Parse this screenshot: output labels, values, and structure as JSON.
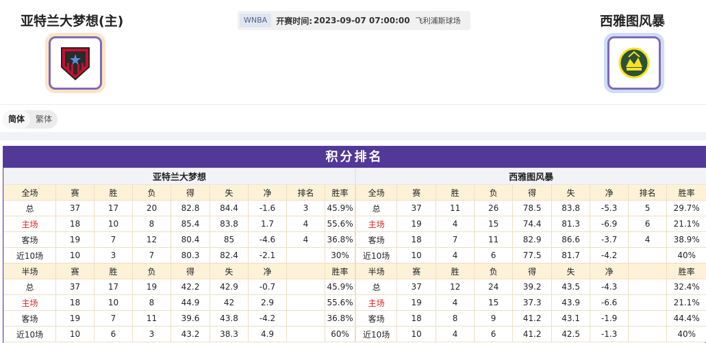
{
  "header": {
    "home_team": "亚特兰大梦想(主)",
    "away_team": "西雅图风暴",
    "league": "WNBA",
    "start_label": "开赛时间:",
    "start_time": "2023-09-07 07:00:00",
    "venue": "飞利浦斯球场",
    "home_ring_color": "#fbe4c7",
    "away_ring_color": "#cfdcfb"
  },
  "lang": {
    "simplified": "简体",
    "traditional": "繁体"
  },
  "panel": {
    "title": "积分排名",
    "accent": "#523897",
    "home_caption": "亚特兰大梦想",
    "away_caption": "西雅图风暴",
    "home": [
      [
        "全场",
        "赛",
        "胜",
        "负",
        "得",
        "失",
        "净",
        "排名",
        "胜率"
      ],
      [
        "总",
        "37",
        "17",
        "20",
        "82.8",
        "84.4",
        "-1.6",
        "3",
        "45.9%"
      ],
      [
        "主场",
        "18",
        "10",
        "8",
        "85.4",
        "83.8",
        "1.7",
        "4",
        "55.6%"
      ],
      [
        "客场",
        "19",
        "7",
        "12",
        "80.4",
        "85",
        "-4.6",
        "4",
        "36.8%"
      ],
      [
        "近10场",
        "10",
        "3",
        "7",
        "80.3",
        "82.4",
        "-2.1",
        "",
        "30%"
      ],
      [
        "半场",
        "赛",
        "胜",
        "负",
        "得",
        "失",
        "净",
        "",
        "胜率"
      ],
      [
        "总",
        "37",
        "17",
        "19",
        "42.2",
        "42.9",
        "-0.7",
        "",
        "45.9%"
      ],
      [
        "主场",
        "18",
        "10",
        "8",
        "44.9",
        "42",
        "2.9",
        "",
        "55.6%"
      ],
      [
        "客场",
        "19",
        "7",
        "11",
        "39.6",
        "43.8",
        "-4.2",
        "",
        "36.8%"
      ],
      [
        "近10场",
        "10",
        "6",
        "3",
        "43.2",
        "38.3",
        "4.9",
        "",
        "60%"
      ]
    ],
    "away": [
      [
        "全场",
        "赛",
        "胜",
        "负",
        "得",
        "失",
        "净",
        "排名",
        "胜率"
      ],
      [
        "总",
        "37",
        "11",
        "26",
        "78.5",
        "83.8",
        "-5.3",
        "5",
        "29.7%"
      ],
      [
        "主场",
        "19",
        "4",
        "15",
        "74.4",
        "81.3",
        "-6.9",
        "6",
        "21.1%"
      ],
      [
        "客场",
        "18",
        "7",
        "11",
        "82.9",
        "86.6",
        "-3.7",
        "4",
        "38.9%"
      ],
      [
        "近10场",
        "10",
        "4",
        "6",
        "77.5",
        "81.7",
        "-4.2",
        "",
        "40%"
      ],
      [
        "半场",
        "赛",
        "胜",
        "负",
        "得",
        "失",
        "净",
        "",
        "胜率"
      ],
      [
        "总",
        "37",
        "12",
        "24",
        "39.2",
        "43.5",
        "-4.3",
        "",
        "32.4%"
      ],
      [
        "主场",
        "19",
        "4",
        "15",
        "37.3",
        "43.9",
        "-6.6",
        "",
        "21.1%"
      ],
      [
        "客场",
        "18",
        "8",
        "9",
        "41.2",
        "43.1",
        "-1.9",
        "",
        "44.4%"
      ],
      [
        "近10场",
        "10",
        "4",
        "6",
        "41.2",
        "42.5",
        "-1.3",
        "",
        "40%"
      ]
    ]
  }
}
